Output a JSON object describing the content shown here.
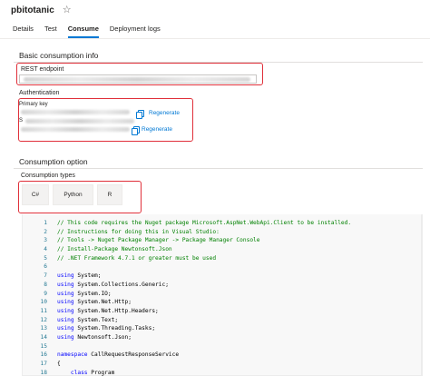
{
  "page": {
    "title": "pbitotanic"
  },
  "tabs": [
    {
      "label": "Details"
    },
    {
      "label": "Test"
    },
    {
      "label": "Consume"
    },
    {
      "label": "Deployment logs"
    }
  ],
  "basic": {
    "section_title": "Basic consumption info",
    "rest_label": "REST endpoint",
    "auth_label": "Authentication",
    "primary_key_label": "Primary key",
    "secondary_key_label": "S",
    "regenerate_primary": "Regenerate",
    "regenerate_secondary": "Regenerate"
  },
  "consumption": {
    "section_title": "Consumption option",
    "types_label": "Consumption types",
    "languages": [
      {
        "label": "C#"
      },
      {
        "label": "Python"
      },
      {
        "label": "R"
      }
    ],
    "selected_language": "C#"
  },
  "code": {
    "lines": [
      {
        "n": "1",
        "t": "// This code requires the Nuget package Microsoft.AspNet.WebApi.Client to be installed."
      },
      {
        "n": "2",
        "t": "// Instructions for doing this in Visual Studio:"
      },
      {
        "n": "3",
        "t": "// Tools -> Nuget Package Manager -> Package Manager Console"
      },
      {
        "n": "4",
        "t": "// Install-Package Newtonsoft.Json"
      },
      {
        "n": "5",
        "t": "// .NET Framework 4.7.1 or greater must be used"
      },
      {
        "n": "6",
        "t": ""
      },
      {
        "n": "7",
        "kw": "using",
        "t": " System;"
      },
      {
        "n": "8",
        "kw": "using",
        "t": " System.Collections.Generic;"
      },
      {
        "n": "9",
        "kw": "using",
        "t": " System.IO;"
      },
      {
        "n": "10",
        "kw": "using",
        "t": " System.Net.Http;"
      },
      {
        "n": "11",
        "kw": "using",
        "t": " System.Net.Http.Headers;"
      },
      {
        "n": "12",
        "kw": "using",
        "t": " System.Text;"
      },
      {
        "n": "13",
        "kw": "using",
        "t": " System.Threading.Tasks;"
      },
      {
        "n": "14",
        "kw": "using",
        "t": " Newtonsoft.Json;"
      },
      {
        "n": "15",
        "t": ""
      },
      {
        "n": "16",
        "kw": "namespace",
        "t": " CallRequestResponseService"
      },
      {
        "n": "17",
        "t": "{"
      },
      {
        "n": "18",
        "kw": "    class",
        "t": " Program"
      }
    ]
  },
  "colors": {
    "accent": "#0078d4",
    "highlight": "#e0303a",
    "comment": "#008000",
    "keyword": "#0000ff"
  }
}
